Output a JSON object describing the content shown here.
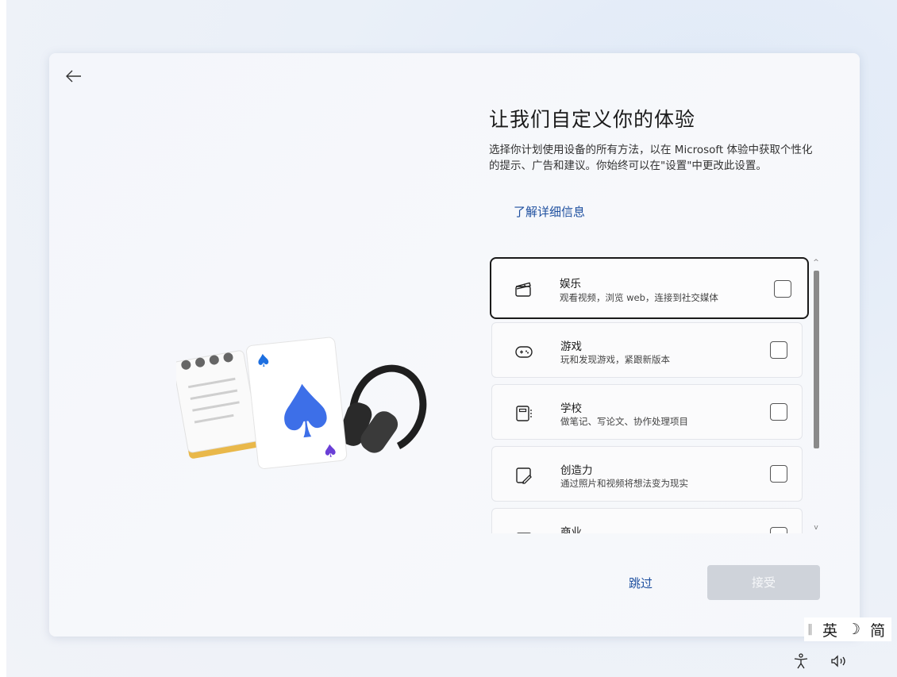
{
  "header": {
    "title": "让我们自定义你的体验",
    "description": "选择你计划使用设备的所有方法，以在 Microsoft 体验中获取个性化的提示、广告和建议。你始终可以在\"设置\"中更改此设置。",
    "learn_more": "了解详细信息"
  },
  "options": [
    {
      "name": "娱乐",
      "sub": "观看视频，浏览 web，连接到社交媒体",
      "icon": "clapperboard-icon",
      "checked": false
    },
    {
      "name": "游戏",
      "sub": "玩和发现游戏，紧跟新版本",
      "icon": "gamepad-icon",
      "checked": false
    },
    {
      "name": "学校",
      "sub": "做笔记、写论文、协作处理项目",
      "icon": "notebook-icon",
      "checked": false
    },
    {
      "name": "创造力",
      "sub": "通过照片和视频将想法变为现实",
      "icon": "draw-icon",
      "checked": false
    },
    {
      "name": "商业",
      "sub": "",
      "icon": "briefcase-icon",
      "checked": false
    }
  ],
  "footer": {
    "skip": "跳过",
    "accept": "接受"
  },
  "ime": {
    "mode": "英",
    "moon": "☽",
    "script": "简"
  },
  "colors": {
    "link": "#1d4f9f",
    "accept_disabled": "#cfd3da"
  }
}
